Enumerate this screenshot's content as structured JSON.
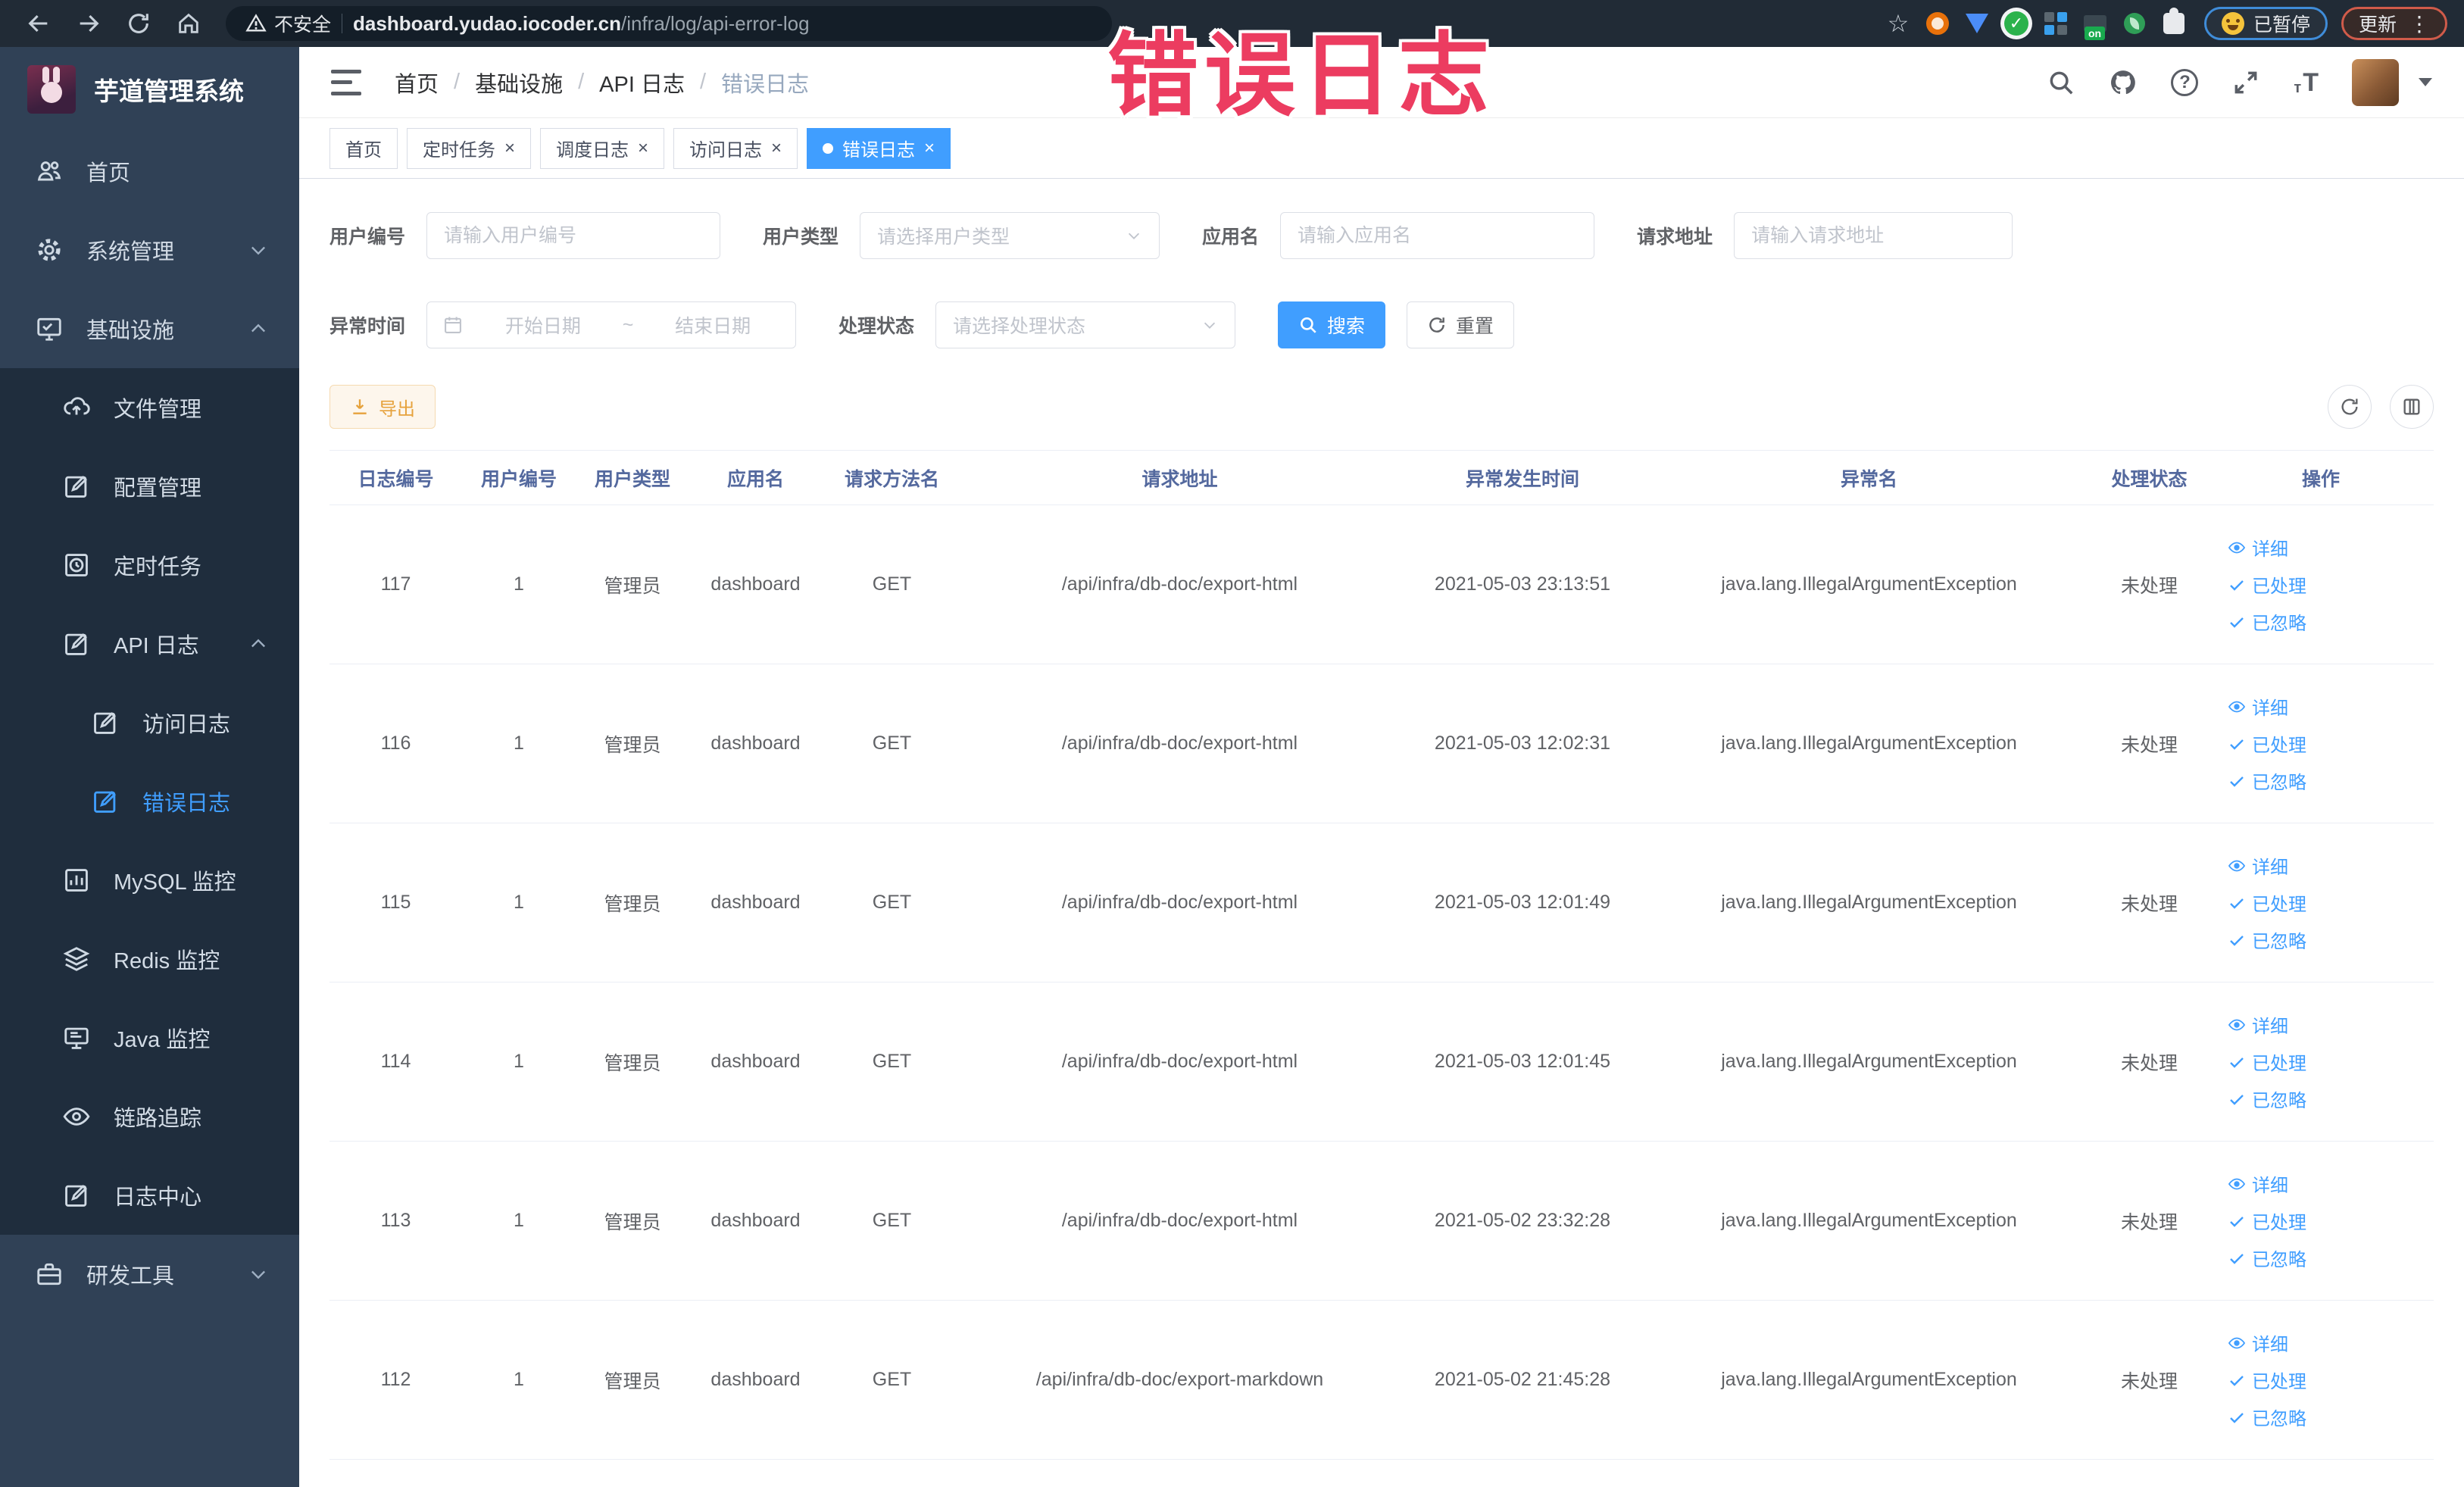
{
  "colors": {
    "primary": "#409EFF",
    "warning": "#E6A23C",
    "sidebar_bg": "#304156",
    "submenu_bg": "#1F2D3D",
    "annotation": "#EC3C60"
  },
  "annotation": {
    "text": "错误日志"
  },
  "browser": {
    "security_label": "不安全",
    "url_host": "dashboard.yudao.iocoder.cn",
    "url_path": "/infra/log/api-error-log",
    "paused_badge": "已暂停",
    "update_badge": "更新"
  },
  "icons": {
    "close": "×",
    "star": "☆",
    "kebab": "⋮",
    "help": "?",
    "font_small": "т",
    "font_big": "T"
  },
  "sidebar": {
    "title": "芋道管理系统",
    "items": {
      "home": "首页",
      "system": "系统管理",
      "infra": "基础设施",
      "file": "文件管理",
      "config": "配置管理",
      "job": "定时任务",
      "apilog": "API 日志",
      "accesslog": "访问日志",
      "errorlog": "错误日志",
      "mysql": "MySQL 监控",
      "redis": "Redis 监控",
      "java": "Java 监控",
      "trace": "链路追踪",
      "logcenter": "日志中心",
      "devtool": "研发工具"
    }
  },
  "header": {
    "breadcrumb": [
      "首页",
      "基础设施",
      "API 日志",
      "错误日志"
    ]
  },
  "tabs": [
    {
      "label": "首页"
    },
    {
      "label": "定时任务"
    },
    {
      "label": "调度日志"
    },
    {
      "label": "访问日志"
    },
    {
      "label": "错误日志"
    }
  ],
  "filters": {
    "user_id": {
      "label": "用户编号",
      "placeholder": "请输入用户编号"
    },
    "user_type": {
      "label": "用户类型",
      "placeholder": "请选择用户类型"
    },
    "app_name": {
      "label": "应用名",
      "placeholder": "请输入应用名"
    },
    "request_url": {
      "label": "请求地址",
      "placeholder": "请输入请求地址"
    },
    "exception_time": {
      "label": "异常时间",
      "start_placeholder": "开始日期",
      "separator": "~",
      "end_placeholder": "结束日期"
    },
    "process_status": {
      "label": "处理状态",
      "placeholder": "请选择处理状态"
    },
    "search_label": "搜索",
    "reset_label": "重置"
  },
  "toolbar": {
    "export_label": "导出"
  },
  "table": {
    "headers": [
      "日志编号",
      "用户编号",
      "用户类型",
      "应用名",
      "请求方法名",
      "请求地址",
      "异常发生时间",
      "异常名",
      "处理状态",
      "操作"
    ],
    "actions": {
      "detail": "详细",
      "processed": "已处理",
      "ignored": "已忽略"
    },
    "rows": [
      {
        "id": "117",
        "user_id": "1",
        "user_type": "管理员",
        "app": "dashboard",
        "method": "GET",
        "url": "/api/infra/db-doc/export-html",
        "time": "2021-05-03 23:13:51",
        "exception": "java.lang.IllegalArgumentException",
        "status": "未处理"
      },
      {
        "id": "116",
        "user_id": "1",
        "user_type": "管理员",
        "app": "dashboard",
        "method": "GET",
        "url": "/api/infra/db-doc/export-html",
        "time": "2021-05-03 12:02:31",
        "exception": "java.lang.IllegalArgumentException",
        "status": "未处理"
      },
      {
        "id": "115",
        "user_id": "1",
        "user_type": "管理员",
        "app": "dashboard",
        "method": "GET",
        "url": "/api/infra/db-doc/export-html",
        "time": "2021-05-03 12:01:49",
        "exception": "java.lang.IllegalArgumentException",
        "status": "未处理"
      },
      {
        "id": "114",
        "user_id": "1",
        "user_type": "管理员",
        "app": "dashboard",
        "method": "GET",
        "url": "/api/infra/db-doc/export-html",
        "time": "2021-05-03 12:01:45",
        "exception": "java.lang.IllegalArgumentException",
        "status": "未处理"
      },
      {
        "id": "113",
        "user_id": "1",
        "user_type": "管理员",
        "app": "dashboard",
        "method": "GET",
        "url": "/api/infra/db-doc/export-html",
        "time": "2021-05-02 23:32:28",
        "exception": "java.lang.IllegalArgumentException",
        "status": "未处理"
      },
      {
        "id": "112",
        "user_id": "1",
        "user_type": "管理员",
        "app": "dashboard",
        "method": "GET",
        "url": "/api/infra/db-doc/export-markdown",
        "time": "2021-05-02 21:45:28",
        "exception": "java.lang.IllegalArgumentException",
        "status": "未处理"
      }
    ]
  }
}
